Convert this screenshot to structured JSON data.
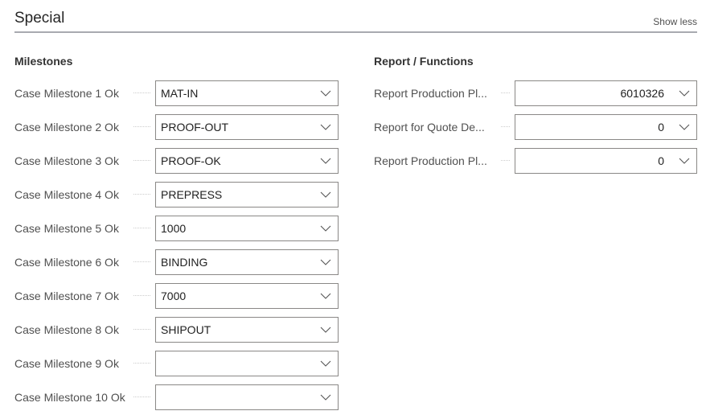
{
  "section": {
    "title": "Special",
    "toggle": "Show less"
  },
  "milestones": {
    "title": "Milestones",
    "rows": [
      {
        "label": "Case Milestone 1 Ok",
        "value": "MAT-IN"
      },
      {
        "label": "Case Milestone 2 Ok",
        "value": "PROOF-OUT"
      },
      {
        "label": "Case Milestone 3 Ok",
        "value": "PROOF-OK"
      },
      {
        "label": "Case Milestone 4 Ok",
        "value": "PREPRESS"
      },
      {
        "label": "Case Milestone 5 Ok",
        "value": "1000"
      },
      {
        "label": "Case Milestone 6 Ok",
        "value": "BINDING"
      },
      {
        "label": "Case Milestone 7 Ok",
        "value": "7000"
      },
      {
        "label": "Case Milestone 8 Ok",
        "value": "SHIPOUT"
      },
      {
        "label": "Case Milestone 9 Ok",
        "value": ""
      },
      {
        "label": "Case Milestone 10 Ok",
        "value": ""
      }
    ]
  },
  "reports": {
    "title": "Report / Functions",
    "rows": [
      {
        "label": "Report Production Pl...",
        "value": "6010326"
      },
      {
        "label": "Report for Quote De...",
        "value": "0"
      },
      {
        "label": "Report Production Pl...",
        "value": "0"
      }
    ]
  }
}
